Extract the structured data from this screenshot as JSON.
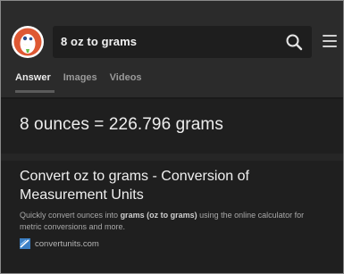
{
  "search": {
    "query": "8 oz to grams"
  },
  "tabs": [
    {
      "label": "Answer",
      "active": true
    },
    {
      "label": "Images",
      "active": false
    },
    {
      "label": "Videos",
      "active": false
    }
  ],
  "answer": {
    "text": "8 ounces = 226.796 grams"
  },
  "result": {
    "title": "Convert oz to grams - Conversion of Measurement Units",
    "snippet_parts": [
      {
        "text": "Quickly convert ounces into ",
        "bold": false
      },
      {
        "text": "grams (oz to grams)",
        "bold": true
      },
      {
        "text": " using the online calculator for metric conversions and more.",
        "bold": false
      }
    ],
    "site": "convertunits.com"
  },
  "colors": {
    "background": "#1f1f1f",
    "header": "#2b2b2b",
    "searchbox": "#1e1e1e",
    "logo_orange": "#de5833"
  },
  "icons": {
    "logo": "duckduckgo-logo",
    "search": "search-icon",
    "menu": "hamburger-menu-icon",
    "favicon": "convertunits-favicon"
  }
}
